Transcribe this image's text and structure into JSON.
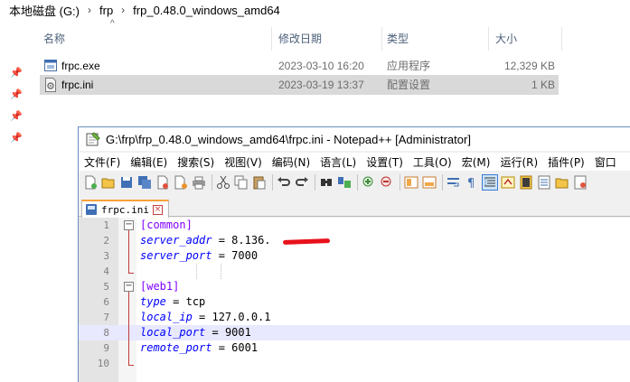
{
  "explorer": {
    "breadcrumb": [
      "本地磁盘 (G:)",
      "frp",
      "frp_0.48.0_windows_amd64"
    ],
    "columns": {
      "name": "名称",
      "date": "修改日期",
      "type": "类型",
      "size": "大小"
    },
    "files": [
      {
        "name": "frpc.exe",
        "date": "2023-03-10 16:20",
        "type": "应用程序",
        "size": "12,329 KB",
        "icon": "exe-icon"
      },
      {
        "name": "frpc.ini",
        "date": "2023-03-19 13:37",
        "type": "配置设置",
        "size": "1 KB",
        "icon": "ini-icon",
        "selected": true
      }
    ]
  },
  "notepad": {
    "title": "G:\\frp\\frp_0.48.0_windows_amd64\\frpc.ini - Notepad++ [Administrator]",
    "menu": [
      "文件(F)",
      "编辑(E)",
      "搜索(S)",
      "视图(V)",
      "编码(N)",
      "语言(L)",
      "设置(T)",
      "工具(O)",
      "宏(M)",
      "运行(R)",
      "插件(P)",
      "窗口"
    ],
    "tab": {
      "label": "frpc.ini"
    },
    "lines": [
      {
        "num": "1",
        "section": "[common]"
      },
      {
        "num": "2",
        "key": "server_addr",
        "eq": " = ",
        "value": "8.136."
      },
      {
        "num": "3",
        "key": "server_port",
        "eq": " = ",
        "value": "7000"
      },
      {
        "num": "4"
      },
      {
        "num": "5",
        "section": "[web1]"
      },
      {
        "num": "6",
        "key": "type",
        "eq": " = ",
        "value": "tcp"
      },
      {
        "num": "7",
        "key": "local_ip",
        "eq": " = ",
        "value": "127.0.0.1"
      },
      {
        "num": "8",
        "key": "local_port",
        "eq": " = ",
        "value": "9001",
        "current": true
      },
      {
        "num": "9",
        "key": "remote_port",
        "eq": " = ",
        "value": "6001"
      },
      {
        "num": "10"
      }
    ],
    "colors": {
      "section": "#8000ff",
      "key": "#0000ff",
      "fold_marker": "#c23b3b",
      "current_line": "#e8e8ff",
      "tab_accent": "#f9a13a"
    }
  }
}
